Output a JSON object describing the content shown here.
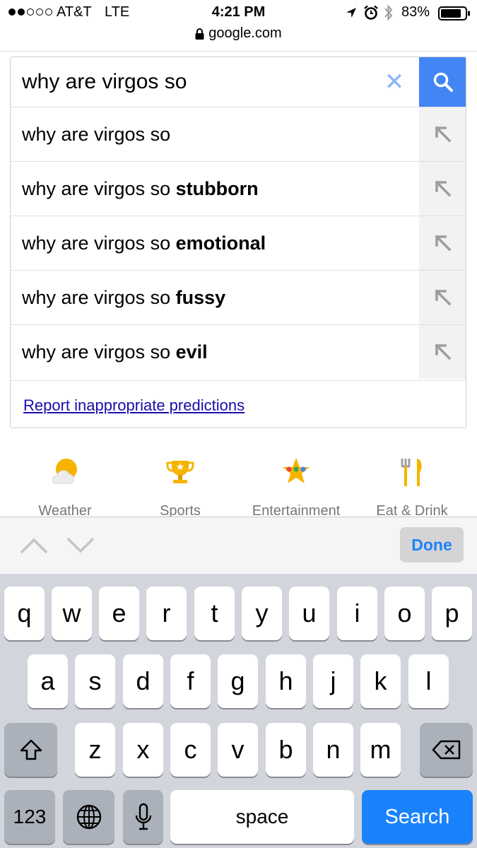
{
  "status_bar": {
    "carrier": "AT&T",
    "network": "LTE",
    "time": "4:21 PM",
    "battery_percent": "83%",
    "signal_bars_filled": 2,
    "signal_bars_total": 5,
    "icons": [
      "location-icon",
      "alarm-icon",
      "bluetooth-icon",
      "battery-icon"
    ]
  },
  "address_bar": {
    "url": "google.com"
  },
  "search": {
    "query": "why are virgos so",
    "suggestions": [
      {
        "prefix": "why are virgos so",
        "completion": ""
      },
      {
        "prefix": "why are virgos so",
        "completion": "stubborn"
      },
      {
        "prefix": "why are virgos so",
        "completion": "emotional"
      },
      {
        "prefix": "why are virgos so",
        "completion": "fussy"
      },
      {
        "prefix": "why are virgos so",
        "completion": "evil"
      }
    ],
    "report_link": "Report inappropriate predictions"
  },
  "categories": [
    {
      "label": "Weather",
      "icon": "weather-icon"
    },
    {
      "label": "Sports",
      "icon": "trophy-icon"
    },
    {
      "label": "Entertainment",
      "icon": "star-icon"
    },
    {
      "label": "Eat & Drink",
      "icon": "fork-knife-icon"
    }
  ],
  "accessory_bar": {
    "done_label": "Done"
  },
  "keyboard": {
    "row1": [
      "q",
      "w",
      "e",
      "r",
      "t",
      "y",
      "u",
      "i",
      "o",
      "p"
    ],
    "row2": [
      "a",
      "s",
      "d",
      "f",
      "g",
      "h",
      "j",
      "k",
      "l"
    ],
    "row3": [
      "z",
      "x",
      "c",
      "v",
      "b",
      "n",
      "m"
    ],
    "numbers_label": "123",
    "space_label": "space",
    "search_label": "Search"
  },
  "colors": {
    "google_blue": "#4285f4",
    "link": "#1a0dab",
    "keyboard_bg": "#d2d5db",
    "ios_blue": "#1a82fb",
    "category_yellow": "#f6b400"
  }
}
